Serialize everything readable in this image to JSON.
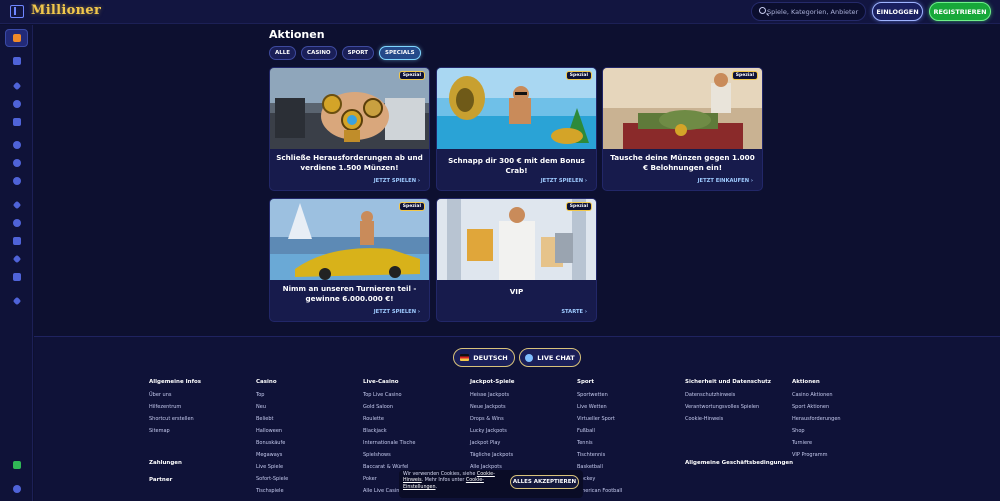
{
  "header": {
    "logo": "Millioner",
    "search_placeholder": "Spiele, Kategorien, Anbieter",
    "login_label": "EINLOGGEN",
    "register_label": "REGISTRIEREN"
  },
  "main": {
    "title": "Aktionen",
    "filters": [
      "ALLE",
      "CASINO",
      "SPORT",
      "SPECIALS"
    ],
    "active_filter": "SPECIALS",
    "cards": [
      {
        "badge": "Spezial",
        "title": "Schließe Herausforderungen ab und verdiene 1.500 Münzen!",
        "cta": "JETZT SPIELEN"
      },
      {
        "badge": "Spezial",
        "title": "Schnapp dir 300 € mit dem Bonus Crab!",
        "cta": "JETZT SPIELEN"
      },
      {
        "badge": "Spezial",
        "title": "Tausche deine Münzen gegen 1.000 € Belohnungen ein!",
        "cta": "JETZT EINKAUFEN"
      },
      {
        "badge": "Spezial",
        "title": "Nimm an unseren Turnieren teil - gewinne 6.000.000 €!",
        "cta": "JETZT SPIELEN"
      },
      {
        "badge": "Spezial",
        "title": "VIP",
        "cta": "STARTE"
      }
    ]
  },
  "footer": {
    "language_label": "DEUTSCH",
    "live_chat_label": "LIVE CHAT",
    "columns": [
      {
        "heading": "Allgemeine Infos",
        "links": [
          "Über uns",
          "Hilfezentrum",
          "Shortcut erstellen",
          "Sitemap"
        ]
      },
      {
        "heading": "Casino",
        "links": [
          "Top",
          "Neu",
          "Beliebt",
          "Halloween",
          "Bonuskäufe",
          "Megaways",
          "Live Spiele",
          "Sofort-Spiele",
          "Tischspiele"
        ]
      },
      {
        "heading": "Live-Casino",
        "links": [
          "Top Live Casino",
          "Gold Saloon",
          "Roulette",
          "Blackjack",
          "Internationale Tische",
          "Spielshows",
          "Baccarat & Würfel",
          "Poker",
          "Alle Live Casinos"
        ]
      },
      {
        "heading": "Jackpot-Spiele",
        "links": [
          "Heisse Jackpots",
          "Neue Jackpots",
          "Drops & Wins",
          "Lucky Jackpots",
          "Jackpot Play",
          "Tägliche Jackpots",
          "Alle Jackpots"
        ]
      },
      {
        "heading": "Sport",
        "links": [
          "Sportwetten",
          "Live Wetten",
          "Virtueller Sport",
          "Fußball",
          "Tennis",
          "Tischtennis",
          "Basketball",
          "Hockey",
          "American Football"
        ]
      },
      {
        "heading": "Sicherheit und Datenschutz",
        "links": [
          "Datenschutzhinweis",
          "Verantwortungsvolles Spielen",
          "Cookie-Hinweis"
        ]
      },
      {
        "heading": "Aktionen",
        "links": [
          "Casino Aktionen",
          "Sport Aktionen",
          "Herausforderungen",
          "Shop",
          "Turniere",
          "VIP Programm"
        ]
      }
    ],
    "extra_headings": [
      "Zahlungen",
      "Partner",
      "Allgemeine Geschäftsbedingungen"
    ]
  },
  "cookie_banner": {
    "text_1": "Wir verwenden Cookies, siehe",
    "link_1": "Cookie-Hinweis",
    "text_2": ". Mehr Infos unter",
    "link_2": "Cookie-Einstellungen",
    "text_3": ".",
    "accept_label": "ALLES AKZEPTIEREN"
  },
  "colors": {
    "background": "#0d1030",
    "accent_gold": "#f2c84b",
    "register_green": "#17a83a",
    "link_blue": "#9fcbff"
  }
}
